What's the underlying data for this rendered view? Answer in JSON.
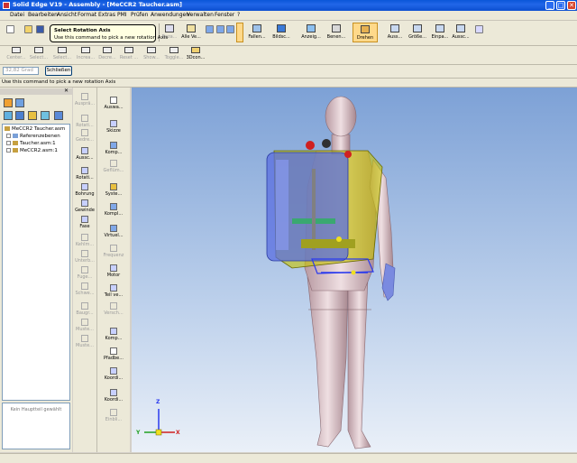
{
  "window": {
    "title": "Solid Edge V19 - Assembly - [MeCCR2 Taucher.asm]",
    "controls": [
      "_",
      "□",
      "✕"
    ]
  },
  "menu": [
    "Datei",
    "Bearbeiten",
    "Ansicht",
    "Format",
    "Extras",
    "PMI",
    "Prüfen",
    "Anwendungen",
    "Verwalten",
    "Fenster",
    "?"
  ],
  "toolbar_top": {
    "buttons": [
      "Beza...",
      "Alle Ve...",
      "Fallen...",
      "Bildsc...",
      "Anzeig...",
      "Benen...",
      "Drehen",
      "Auss...",
      "Größe...",
      "Einpa...",
      "Aussc..."
    ]
  },
  "toolbar_second": {
    "buttons": [
      "Center...",
      "Select...",
      "Select...",
      "Increa...",
      "Decre...",
      "Reset ...",
      "Show...",
      "Toggle...",
      "3Dcon..."
    ]
  },
  "tooltip": {
    "title": "Select Rotation Axis",
    "text": "Use this command to pick a new rotation Axis"
  },
  "ribbon": {
    "distance_value": "32,82 Grad",
    "close_label": "Schließen"
  },
  "prompt_text": "Use this command to pick a new rotation Axis",
  "tree": {
    "items": [
      {
        "label": "MeCCR2 Taucher.asm",
        "level": 0
      },
      {
        "label": "Referenzebenen",
        "level": 1
      },
      {
        "label": "Taucher.asm:1",
        "level": 1
      },
      {
        "label": "MeCCR2.asm:1",
        "level": 1
      }
    ]
  },
  "properties_empty": "Kein Hauptteil gewählt",
  "tools_col1": [
    "Ausprä...",
    "Rotati...",
    "Gedre...",
    "Aussc...",
    "Rotati...",
    "Bohrung",
    "Gewinde",
    "Fase",
    "Kehlm...",
    "Unterb...",
    "Fuge...",
    "Schwe...",
    "Baugr...",
    "Muste...",
    "Muste..."
  ],
  "tools_col2": [
    "Auswa...",
    "Skizze",
    "Komp...",
    "Geflüm...",
    "Syste...",
    "Kompl...",
    "Virtuel...",
    "Frequenz",
    "Motor",
    "Teil ve...",
    "Versch...",
    "Komp...",
    "Pfadbe...",
    "Koordi...",
    "Koordi...",
    "Einbli..."
  ],
  "colors": {
    "title_bar": "#0a56d8",
    "viewport_top": "#7da1d6",
    "viewport_bottom": "#eaf0f8",
    "model_skin": "#d8c1c6",
    "backpack_yellow": "#c8c400",
    "tank_blue": "#5a6ee0"
  },
  "axes": [
    "Z",
    "X",
    "Y"
  ]
}
